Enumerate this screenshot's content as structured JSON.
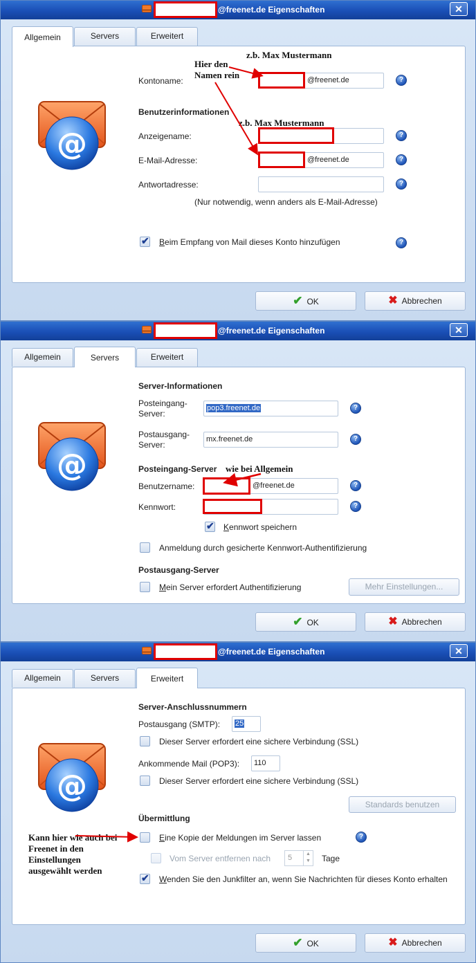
{
  "title_suffix": "@freenet.de Eigenschaften",
  "tabs": [
    "Allgemein",
    "Servers",
    "Erweitert"
  ],
  "help_glyph": "?",
  "close_glyph": "✕",
  "buttons": {
    "ok": "OK",
    "cancel": "Abbrechen"
  },
  "general": {
    "account_name_label": "Kontoname:",
    "account_name_value": "@freenet.de",
    "user_info_heading": "Benutzerinformationen",
    "display_name_label": "Anzeigename:",
    "email_label": "E-Mail-Adresse:",
    "email_value": "@freenet.de",
    "reply_label": "Antwortadresse:",
    "reply_hint": "(Nur notwendig, wenn anders als E-Mail-Adresse)",
    "include_label": "Beim Empfang von Mail dieses Konto hinzufügen",
    "include_checked": true,
    "annotations": {
      "name_here": "Hier den Namen rein",
      "example1": "z.b. Max Mustermann",
      "example2": "z.b. Max Mustermann"
    }
  },
  "servers": {
    "server_info_heading": "Server-Informationen",
    "incoming_label": "Posteingang-Server:",
    "incoming_value": "pop3.freenet.de",
    "outgoing_label": "Postausgang-Server:",
    "outgoing_value": "mx.freenet.de",
    "incoming_server_heading": "Posteingang-Server",
    "username_label": "Benutzername:",
    "username_value": "@freenet.de",
    "password_label": "Kennwort:",
    "remember_password_label": "Kennwort speichern",
    "remember_password_checked": true,
    "spa_label": "Anmeldung durch gesicherte Kennwort-Authentifizierung",
    "spa_checked": false,
    "outgoing_server_heading": "Postausgang-Server",
    "auth_label": "Mein Server erfordert Authentifizierung",
    "auth_checked": false,
    "more_settings_button": "Mehr Einstellungen...",
    "annotation": "wie bei Allgemein"
  },
  "advanced": {
    "port_heading": "Server-Anschlussnummern",
    "smtp_label": "Postausgang (SMTP):",
    "smtp_value": "25",
    "smtp_ssl_label": "Dieser Server erfordert eine sichere Verbindung (SSL)",
    "pop3_label": "Ankommende Mail (POP3):",
    "pop3_value": "110",
    "pop3_ssl_label": "Dieser Server erfordert eine sichere Verbindung (SSL)",
    "defaults_button": "Standards benutzen",
    "delivery_heading": "Übermittlung",
    "leave_copy_label": "Eine Kopie der Meldungen im Server lassen",
    "leave_copy_checked": false,
    "remove_after_label": "Vom Server entfernen nach",
    "remove_after_value": "5",
    "days_label": "Tage",
    "junk_label": "Wenden Sie den Junkfilter an, wenn Sie Nachrichten für dieses Konto erhalten",
    "junk_checked": true,
    "annotation": "Kann hier wie auch bei Freenet in den Einstellungen ausgewählt werden"
  },
  "colors": {
    "titlebar": "#1a4fb6",
    "redact": "#e00000",
    "help": "#1f55b8",
    "ok": "#33a02c",
    "cancel": "#d81b1b"
  }
}
